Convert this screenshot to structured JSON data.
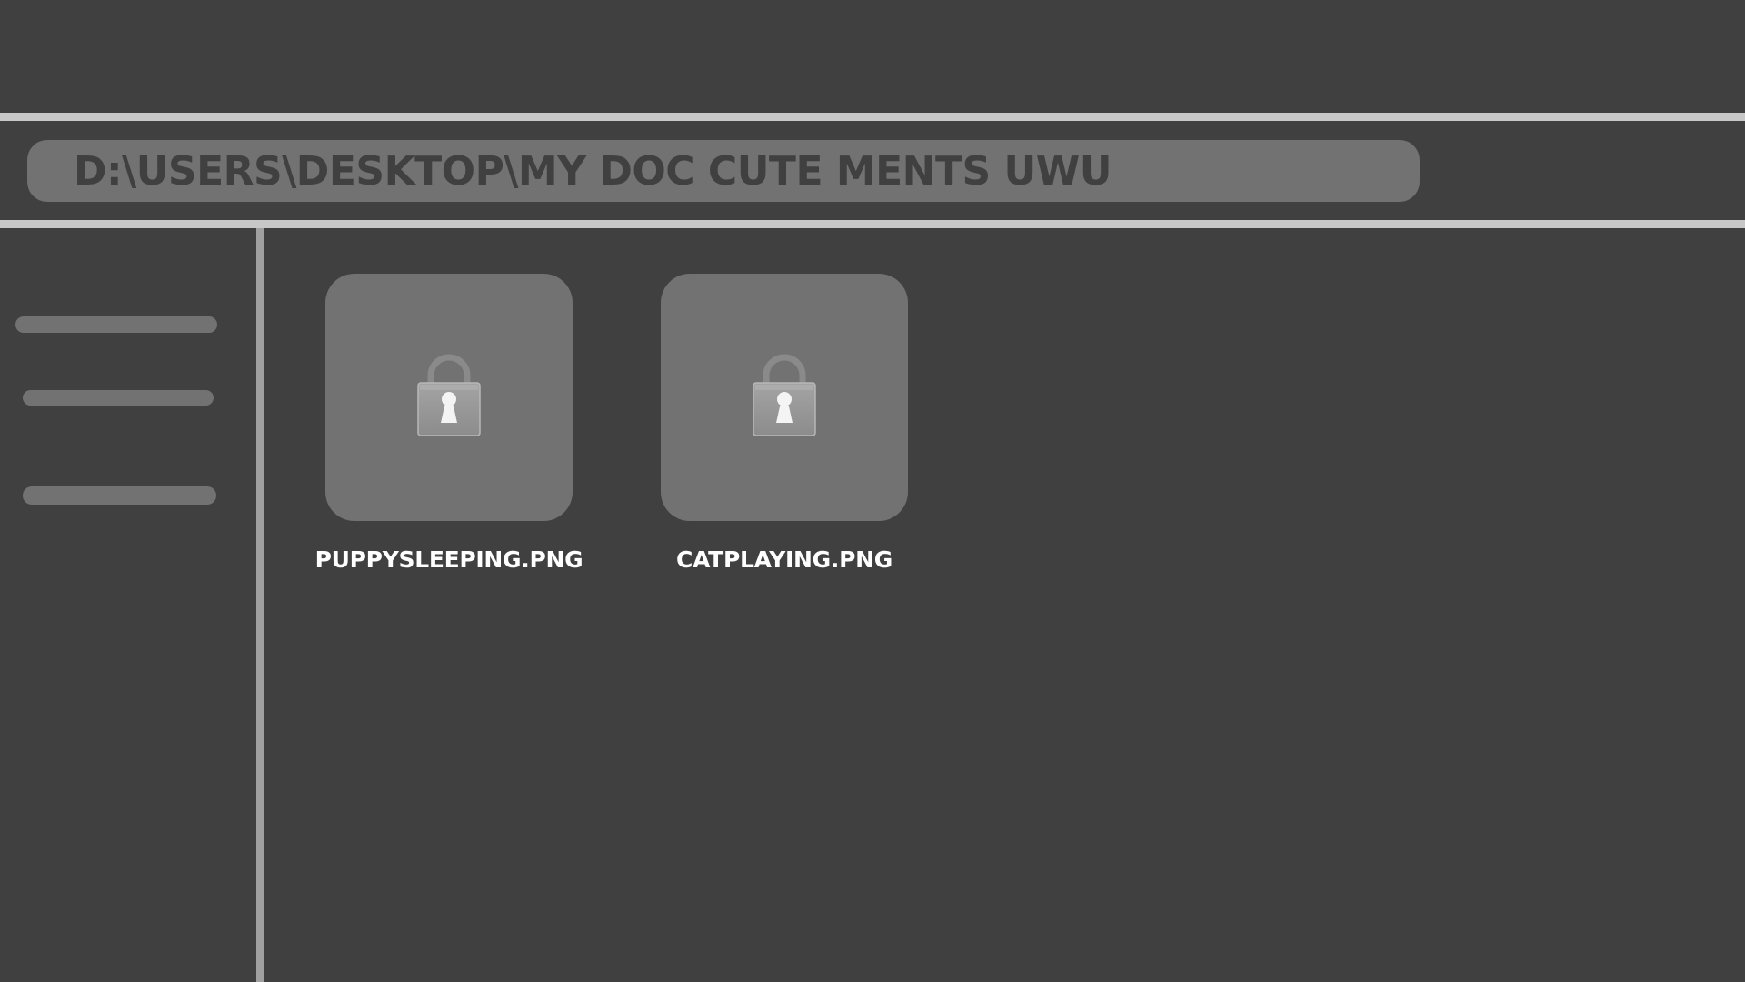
{
  "address_bar": {
    "path": "D:\\USERS\\DESKTOP\\MY DOC CUTE MENTS UWU"
  },
  "sidebar": {
    "items": [
      {
        "label": ""
      },
      {
        "label": ""
      },
      {
        "label": ""
      }
    ]
  },
  "files": [
    {
      "name": "PUPPYSLEEPING.PNG",
      "icon": "lock-icon"
    },
    {
      "name": "CATPLAYING.PNG",
      "icon": "lock-icon"
    }
  ],
  "colors": {
    "background": "#404040",
    "panel": "#727272",
    "rule": "#c8c8c8",
    "divider": "#a0a0a0",
    "label_text": "#ffffff"
  }
}
